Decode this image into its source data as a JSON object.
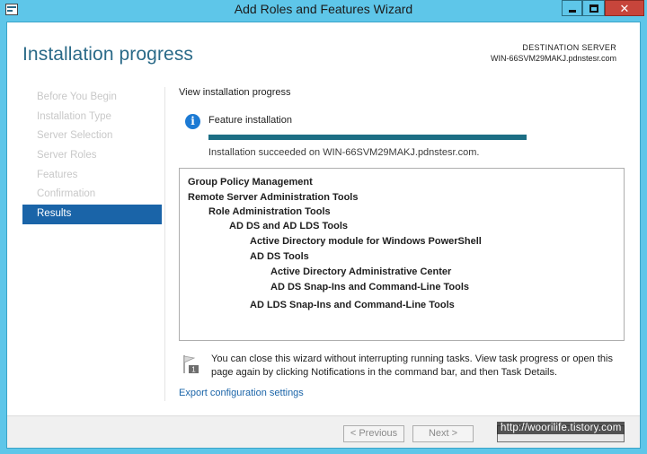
{
  "window": {
    "title": "Add Roles and Features Wizard",
    "close_glyph": "✕"
  },
  "header": {
    "title": "Installation progress",
    "destination_label": "DESTINATION SERVER",
    "destination_server": "WIN-66SVM29MAKJ.pdnstesr.com"
  },
  "nav": {
    "items": [
      {
        "label": "Before You Begin",
        "active": false
      },
      {
        "label": "Installation Type",
        "active": false
      },
      {
        "label": "Server Selection",
        "active": false
      },
      {
        "label": "Server Roles",
        "active": false
      },
      {
        "label": "Features",
        "active": false
      },
      {
        "label": "Confirmation",
        "active": false
      },
      {
        "label": "Results",
        "active": true
      }
    ]
  },
  "content": {
    "subtitle": "View installation progress",
    "info_icon": "i",
    "feature_label": "Feature installation",
    "progress_fraction": 1.0,
    "status": "Installation succeeded on WIN-66SVM29MAKJ.pdnstesr.com.",
    "results": [
      {
        "label": "Group Policy Management",
        "level": 0
      },
      {
        "label": "Remote Server Administration Tools",
        "level": 0
      },
      {
        "label": "Role Administration Tools",
        "level": 1
      },
      {
        "label": "AD DS and AD LDS Tools",
        "level": 2
      },
      {
        "label": "Active Directory module for Windows PowerShell",
        "level": 3
      },
      {
        "label": "AD DS Tools",
        "level": 3
      },
      {
        "label": "Active Directory Administrative Center",
        "level": 4
      },
      {
        "label": "AD DS Snap-Ins and Command-Line Tools",
        "level": 4
      },
      {
        "label": "AD LDS Snap-Ins and Command-Line Tools",
        "level": 3
      }
    ],
    "notice_badge": "1",
    "notice": "You can close this wizard without interrupting running tasks. View task progress or open this page again by clicking Notifications in the command bar, and then Task Details.",
    "export_link": "Export configuration settings"
  },
  "footer": {
    "previous_label": "< Previous",
    "next_label": "Next >",
    "watermark": "http://woorilife.tistory.com"
  },
  "colors": {
    "accent": "#1a64a8",
    "titlebar": "#5ec6e9",
    "close": "#c7453b",
    "progress": "#1c6e84"
  }
}
